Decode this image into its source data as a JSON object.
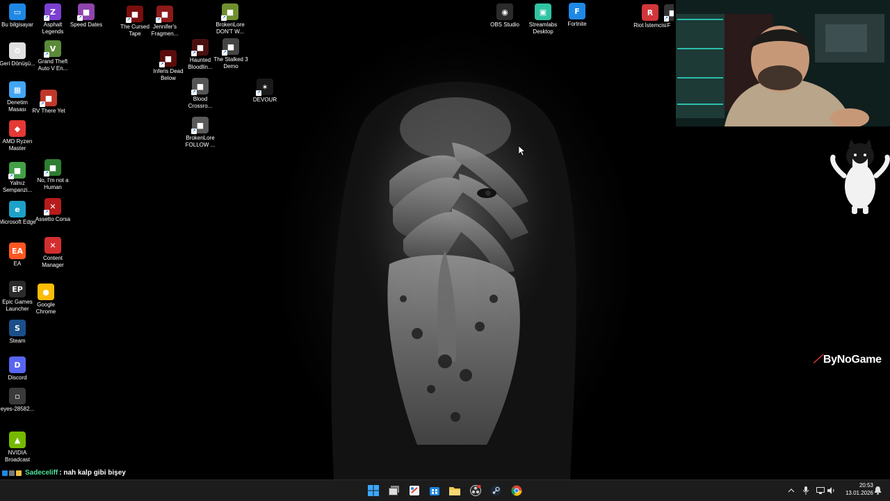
{
  "desktop": {
    "icons": [
      {
        "label": "Bu bilgisayar",
        "icon": "computer-icon",
        "color": "#1e88e5"
      },
      {
        "label": "Geri Dönüşü...",
        "icon": "recycle-bin-icon",
        "color": "#e0e0e0"
      },
      {
        "label": "Denetim Masası",
        "icon": "control-panel-icon",
        "color": "#42a5f5"
      },
      {
        "label": "AMD Ryzen Master",
        "icon": "amd-ryzen-icon",
        "color": "#e53935"
      },
      {
        "label": "Yalnız Sempanzi...",
        "icon": "game-icon",
        "color": "#43a047"
      },
      {
        "label": "Microsoft Edge",
        "icon": "edge-icon",
        "color": "#1da1c7"
      },
      {
        "label": "EA",
        "icon": "ea-icon",
        "color": "#ff5722"
      },
      {
        "label": "Epic Games Launcher",
        "icon": "epic-games-icon",
        "color": "#2b2b2b"
      },
      {
        "label": "Steam",
        "icon": "steam-icon",
        "color": "#1b4f8a"
      },
      {
        "label": "Discord",
        "icon": "discord-icon",
        "color": "#5865f2"
      },
      {
        "label": "eyes-28582...",
        "icon": "file-icon",
        "color": "#3a3a3a"
      },
      {
        "label": "NVIDIA Broadcast",
        "icon": "nvidia-broadcast-icon",
        "color": "#76b900"
      },
      {
        "label": "Asphalt Legends",
        "icon": "asphalt-icon",
        "color": "#7b3fd1"
      },
      {
        "label": "Grand Theft Auto V En...",
        "icon": "gta-icon",
        "color": "#5a8a3a"
      },
      {
        "label": "RV There Yet",
        "icon": "game-icon",
        "color": "#c0392b"
      },
      {
        "label": "No, I'm not a Human",
        "icon": "game-icon",
        "color": "#2e7d32"
      },
      {
        "label": "Assetto Corsa",
        "icon": "assetto-corsa-icon",
        "color": "#b71c1c"
      },
      {
        "label": "Content Manager",
        "icon": "content-manager-icon",
        "color": "#d32f2f"
      },
      {
        "label": "Google Chrome",
        "icon": "chrome-icon",
        "color": "#fbbc05"
      },
      {
        "label": "Speed Dates",
        "icon": "game-icon",
        "color": "#8e44ad"
      },
      {
        "label": "The Cursed Tape",
        "icon": "game-icon",
        "color": "#7a0d0d"
      },
      {
        "label": "Jennifer's Fragmen...",
        "icon": "game-icon",
        "color": "#8b1a1a"
      },
      {
        "label": "Inferis Dead Below",
        "icon": "game-icon",
        "color": "#5a0c0c"
      },
      {
        "label": "BrokenLore DON'T W...",
        "icon": "game-icon",
        "color": "#6f8f2f"
      },
      {
        "label": "Haunted Bloodlin...",
        "icon": "game-icon",
        "color": "#4a1010"
      },
      {
        "label": "The Stalked 3 Demo",
        "icon": "game-icon",
        "color": "#444"
      },
      {
        "label": "Blood Crossro...",
        "icon": "game-icon",
        "color": "#555"
      },
      {
        "label": "BrokenLore FOLLOW ...",
        "icon": "game-icon",
        "color": "#5a5a5a"
      },
      {
        "label": "DEVOUR",
        "icon": "devour-icon",
        "color": "#1a1a1a"
      },
      {
        "label": "OBS Studio",
        "icon": "obs-icon",
        "color": "#2b2b2b"
      },
      {
        "label": "Streamlabs Desktop",
        "icon": "streamlabs-icon",
        "color": "#31c3a2"
      },
      {
        "label": "Fortnite",
        "icon": "fortnite-icon",
        "color": "#1e88e5"
      },
      {
        "label": "Riot İstemcisi",
        "icon": "riot-icon",
        "color": "#d13639"
      },
      {
        "label": "F",
        "icon": "game-icon",
        "color": "#333"
      }
    ]
  },
  "overlay": {
    "brand": "ByNoGame",
    "chat": {
      "user": "Sadeceliff",
      "message": ": nah kalp gibi bişey"
    }
  },
  "taskbar": {
    "apps": [
      {
        "icon": "windows-start-icon",
        "name": "Start"
      },
      {
        "icon": "task-view-icon",
        "name": "Task View"
      },
      {
        "icon": "snipping-icon",
        "name": "App"
      },
      {
        "icon": "store-icon",
        "name": "Store"
      },
      {
        "icon": "file-explorer-icon",
        "name": "File Explorer"
      },
      {
        "icon": "obs-icon",
        "name": "OBS Studio"
      },
      {
        "icon": "steam-icon",
        "name": "Steam"
      },
      {
        "icon": "chrome-icon",
        "name": "Google Chrome"
      }
    ],
    "tray": {
      "time": "20:53",
      "date": "13.01.2026"
    }
  }
}
